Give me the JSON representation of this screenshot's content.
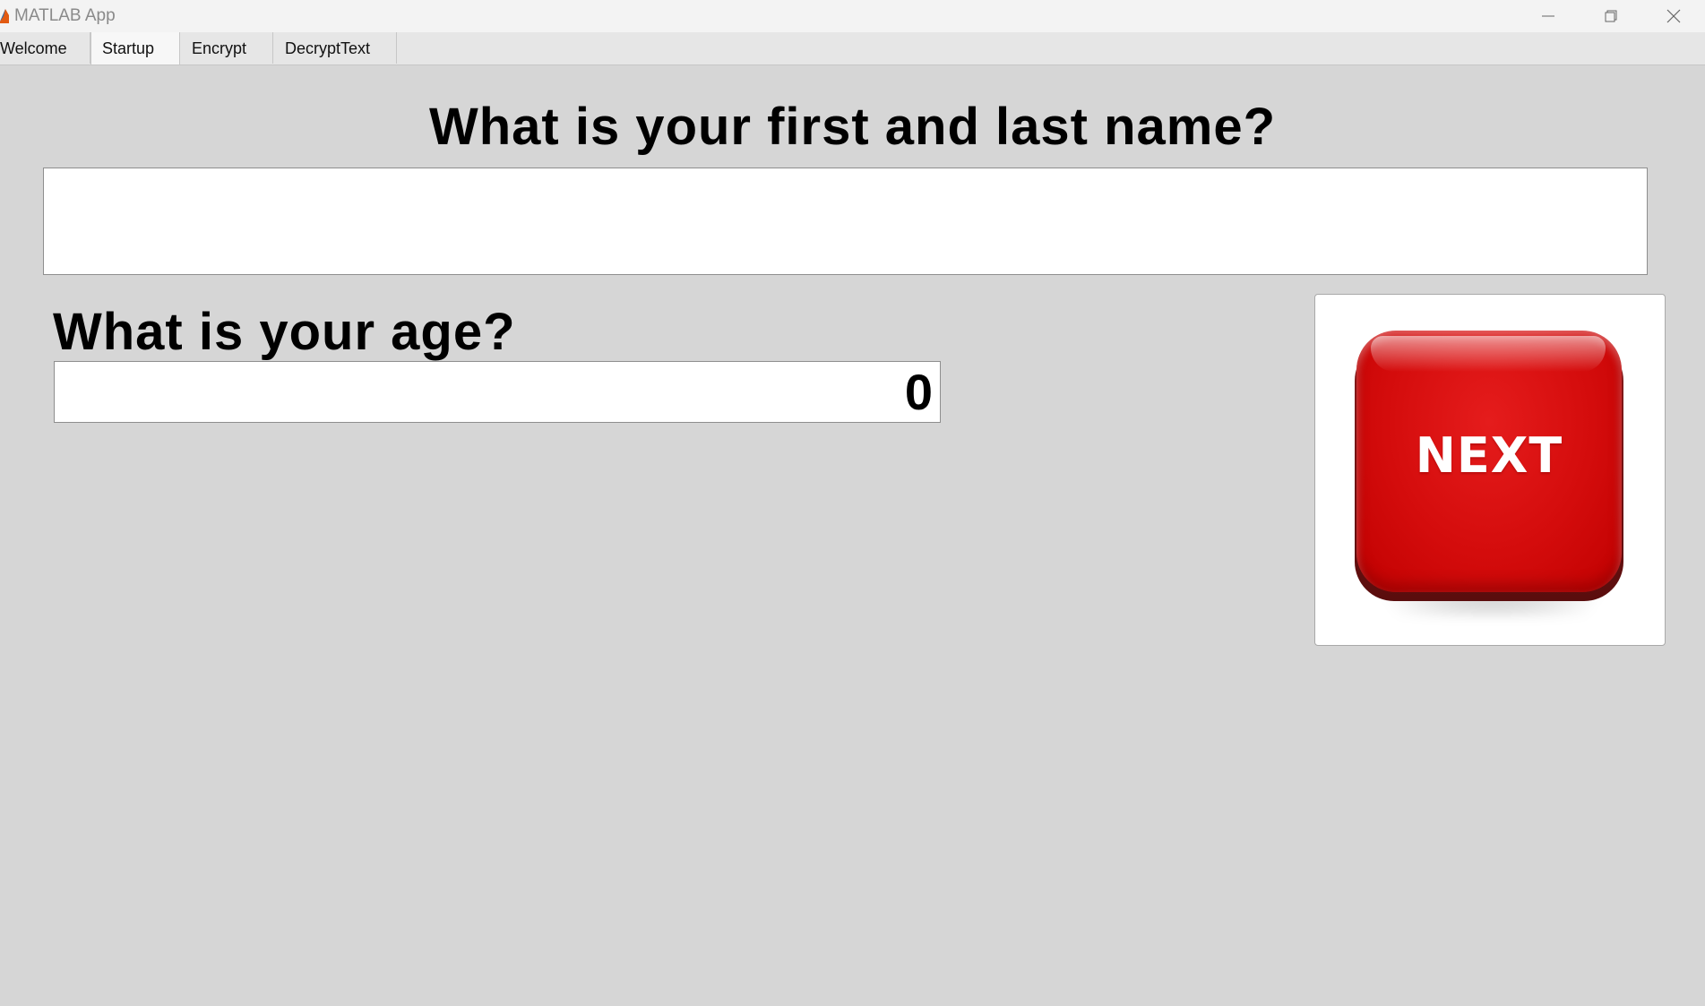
{
  "window": {
    "title": "MATLAB App",
    "controls": {
      "minimize_icon": "minimize-icon",
      "restore_icon": "restore-icon",
      "close_icon": "close-icon"
    }
  },
  "tabs": [
    {
      "label": "Welcome",
      "active": false
    },
    {
      "label": "Startup",
      "active": true
    },
    {
      "label": "Encrypt",
      "active": false
    },
    {
      "label": "DecryptText",
      "active": false
    }
  ],
  "startup": {
    "name_question": "What is your first and last name?",
    "name_value": "",
    "age_question": "What is your age?",
    "age_value": "0",
    "next_button_label": "NEXT"
  },
  "colors": {
    "background": "#d6d6d6",
    "next_button_red": "#d40c0c",
    "input_background": "#ffffff"
  }
}
